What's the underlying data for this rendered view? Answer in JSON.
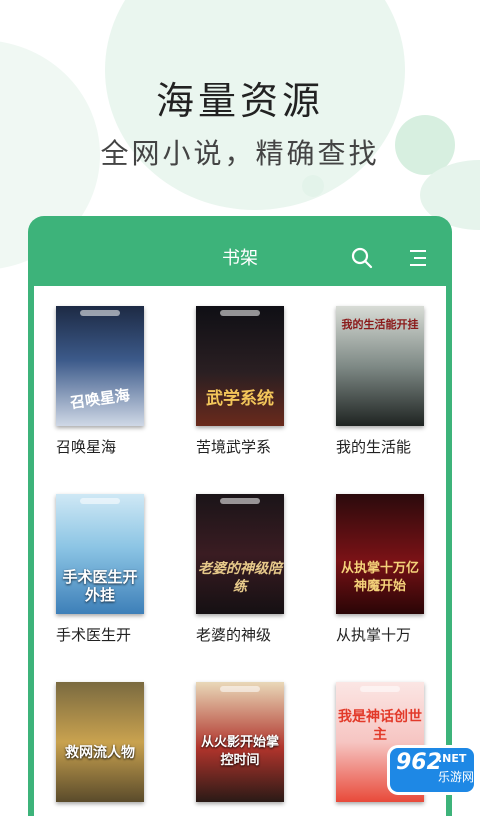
{
  "hero": {
    "title": "海量资源",
    "subtitle": "全网小说，精确查找"
  },
  "appbar": {
    "title": "书架",
    "search_icon": "search-icon",
    "menu_icon": "menu-icon"
  },
  "accent_color": "#3db37a",
  "books": [
    {
      "title": "召唤星海",
      "cover_text": "召唤星海"
    },
    {
      "title": "苦境武学系",
      "cover_text": "武学系统"
    },
    {
      "title": "我的生活能",
      "cover_text": "我的生活能开挂"
    },
    {
      "title": "手术医生开",
      "cover_text": "手术医生开外挂"
    },
    {
      "title": "老婆的神级",
      "cover_text": "老婆的神级陪练"
    },
    {
      "title": "从执掌十万",
      "cover_text": "从执掌十万亿神魔开始"
    },
    {
      "title": "",
      "cover_text": "救网流人物"
    },
    {
      "title": "",
      "cover_text": "从火影开始掌控时间"
    },
    {
      "title": "",
      "cover_text": "我是神话创世主"
    }
  ],
  "watermark": {
    "number": "962",
    "net": ".NET",
    "label": "乐游网"
  }
}
